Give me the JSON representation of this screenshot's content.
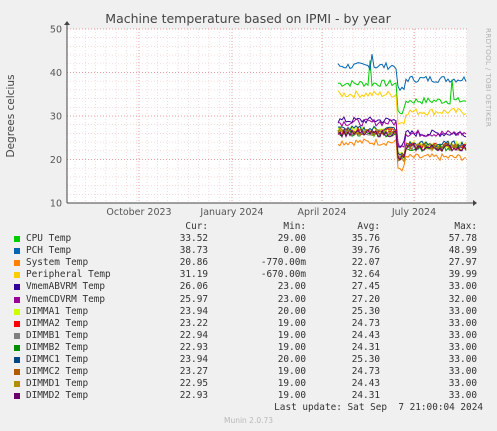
{
  "chart_data": {
    "type": "line",
    "title": "Machine temperature based on IPMI - by year",
    "ylabel": "Degrees celcius",
    "ylim": [
      10,
      50
    ],
    "y_ticks": [
      "10",
      "20",
      "30",
      "40",
      "50"
    ],
    "x_ticks": [
      "October 2023",
      "January 2024",
      "April 2024",
      "July 2024"
    ],
    "grid": true,
    "side_text": "RRDTOOL / TOBI OETIKER",
    "series": [
      {
        "name": "CPU Temp",
        "color": "#00cc00",
        "cur": "33.52",
        "min": "29.00",
        "avg": "35.76",
        "max": "57.78",
        "base": 37.5,
        "late": 33.5
      },
      {
        "name": "PCH Temp",
        "color": "#0066b3",
        "cur": "38.73",
        "min": "0.00",
        "avg": "39.76",
        "max": "48.99",
        "base": 41.5,
        "late": 38.5
      },
      {
        "name": "System Temp",
        "color": "#ff8000",
        "cur": "20.86",
        "min": "-770.00m",
        "avg": "22.07",
        "max": "27.97",
        "base": 24.0,
        "late": 20.5
      },
      {
        "name": "Peripheral Temp",
        "color": "#ffcc00",
        "cur": "31.19",
        "min": "-670.00m",
        "avg": "32.64",
        "max": "39.99",
        "base": 35.0,
        "late": 31.0
      },
      {
        "name": "VmemABVRM Temp",
        "color": "#330099",
        "cur": "26.06",
        "min": "23.00",
        "avg": "27.45",
        "max": "33.00",
        "base": 29.0,
        "late": 26.0
      },
      {
        "name": "VmemCDVRM Temp",
        "color": "#990099",
        "cur": "25.97",
        "min": "23.00",
        "avg": "27.20",
        "max": "32.00",
        "base": 28.5,
        "late": 26.0
      },
      {
        "name": "DIMMA1 Temp",
        "color": "#ccff00",
        "cur": "23.94",
        "min": "20.00",
        "avg": "25.30",
        "max": "33.00",
        "base": 27.0,
        "late": 23.5
      },
      {
        "name": "DIMMA2 Temp",
        "color": "#ff0000",
        "cur": "23.22",
        "min": "19.00",
        "avg": "24.73",
        "max": "33.00",
        "base": 26.5,
        "late": 23.0
      },
      {
        "name": "DIMMB1 Temp",
        "color": "#808080",
        "cur": "22.94",
        "min": "19.00",
        "avg": "24.43",
        "max": "33.00",
        "base": 26.2,
        "late": 22.8
      },
      {
        "name": "DIMMB2 Temp",
        "color": "#008f00",
        "cur": "22.93",
        "min": "19.00",
        "avg": "24.31",
        "max": "33.00",
        "base": 26.0,
        "late": 22.7
      },
      {
        "name": "DIMMC1 Temp",
        "color": "#00487d",
        "cur": "23.94",
        "min": "20.00",
        "avg": "25.30",
        "max": "33.00",
        "base": 27.0,
        "late": 23.5
      },
      {
        "name": "DIMMC2 Temp",
        "color": "#b35a00",
        "cur": "23.27",
        "min": "19.00",
        "avg": "24.73",
        "max": "33.00",
        "base": 26.5,
        "late": 23.0
      },
      {
        "name": "DIMMD1 Temp",
        "color": "#b38f00",
        "cur": "22.95",
        "min": "19.00",
        "avg": "24.43",
        "max": "33.00",
        "base": 26.2,
        "late": 22.8
      },
      {
        "name": "DIMMD2 Temp",
        "color": "#6b006b",
        "cur": "22.93",
        "min": "19.00",
        "avg": "24.31",
        "max": "33.00",
        "base": 26.0,
        "late": 22.7
      }
    ]
  },
  "legend": {
    "headers": {
      "cur": "Cur:",
      "min": "Min:",
      "avg": "Avg:",
      "max": "Max:"
    }
  },
  "footer": {
    "last_update": "Last update: Sat Sep  7 21:00:04 2024",
    "munin": "Munin 2.0.73"
  }
}
